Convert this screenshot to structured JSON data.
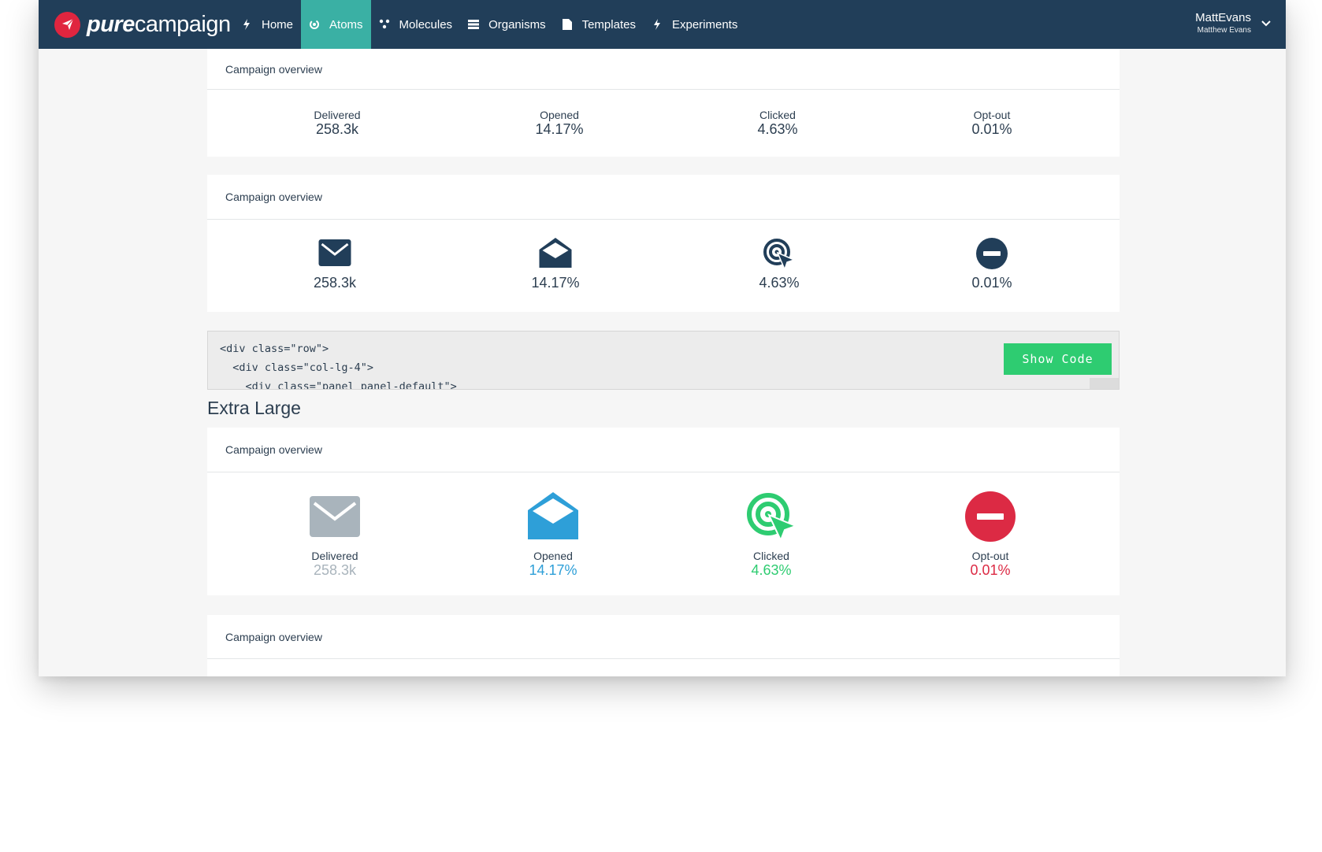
{
  "brand": {
    "pure": "pure",
    "campaign": "campaign"
  },
  "nav": [
    {
      "label": "Home",
      "icon": "bolt-icon"
    },
    {
      "label": "Atoms",
      "icon": "atom-icon",
      "active": true
    },
    {
      "label": "Molecules",
      "icon": "molecule-icon"
    },
    {
      "label": "Organisms",
      "icon": "grid-icon"
    },
    {
      "label": "Templates",
      "icon": "document-icon"
    },
    {
      "label": "Experiments",
      "icon": "bolt-icon"
    }
  ],
  "user": {
    "username": "MattEvans",
    "full_name": "Matthew Evans"
  },
  "panel1": {
    "heading": "Campaign overview",
    "stats": [
      {
        "label": "Delivered",
        "value": "258.3k"
      },
      {
        "label": "Opened",
        "value": "14.17%"
      },
      {
        "label": "Clicked",
        "value": "4.63%"
      },
      {
        "label": "Opt-out",
        "value": "0.01%"
      }
    ]
  },
  "panel2": {
    "heading": "Campaign overview",
    "stats": [
      {
        "icon": "envelope-icon",
        "value": "258.3k"
      },
      {
        "icon": "envelope-open-icon",
        "value": "14.17%"
      },
      {
        "icon": "target-cursor-icon",
        "value": "4.63%"
      },
      {
        "icon": "minus-circle-icon",
        "value": "0.01%"
      }
    ]
  },
  "code": {
    "lines": [
      "<div class=\"row\">",
      "  <div class=\"col-lg-4\">",
      "    <div class=\"panel panel-default\">"
    ],
    "button": "Show Code"
  },
  "section_title": "Extra Large",
  "panel3": {
    "heading": "Campaign overview",
    "stats": [
      {
        "label": "Delivered",
        "value": "258.3k",
        "color": "#a9b4bc",
        "icon": "envelope-icon"
      },
      {
        "label": "Opened",
        "value": "14.17%",
        "color": "#2e9fd8",
        "icon": "envelope-open-icon"
      },
      {
        "label": "Clicked",
        "value": "4.63%",
        "color": "#2ecc71",
        "icon": "target-cursor-icon"
      },
      {
        "label": "Opt-out",
        "value": "0.01%",
        "color": "#dc2a44",
        "icon": "minus-circle-icon"
      }
    ]
  },
  "panel4": {
    "heading": "Campaign overview"
  },
  "colors": {
    "navbar": "#213e59",
    "active_tab": "#3ab0a4",
    "show_code": "#2ecc71",
    "text": "#2c3e50"
  }
}
